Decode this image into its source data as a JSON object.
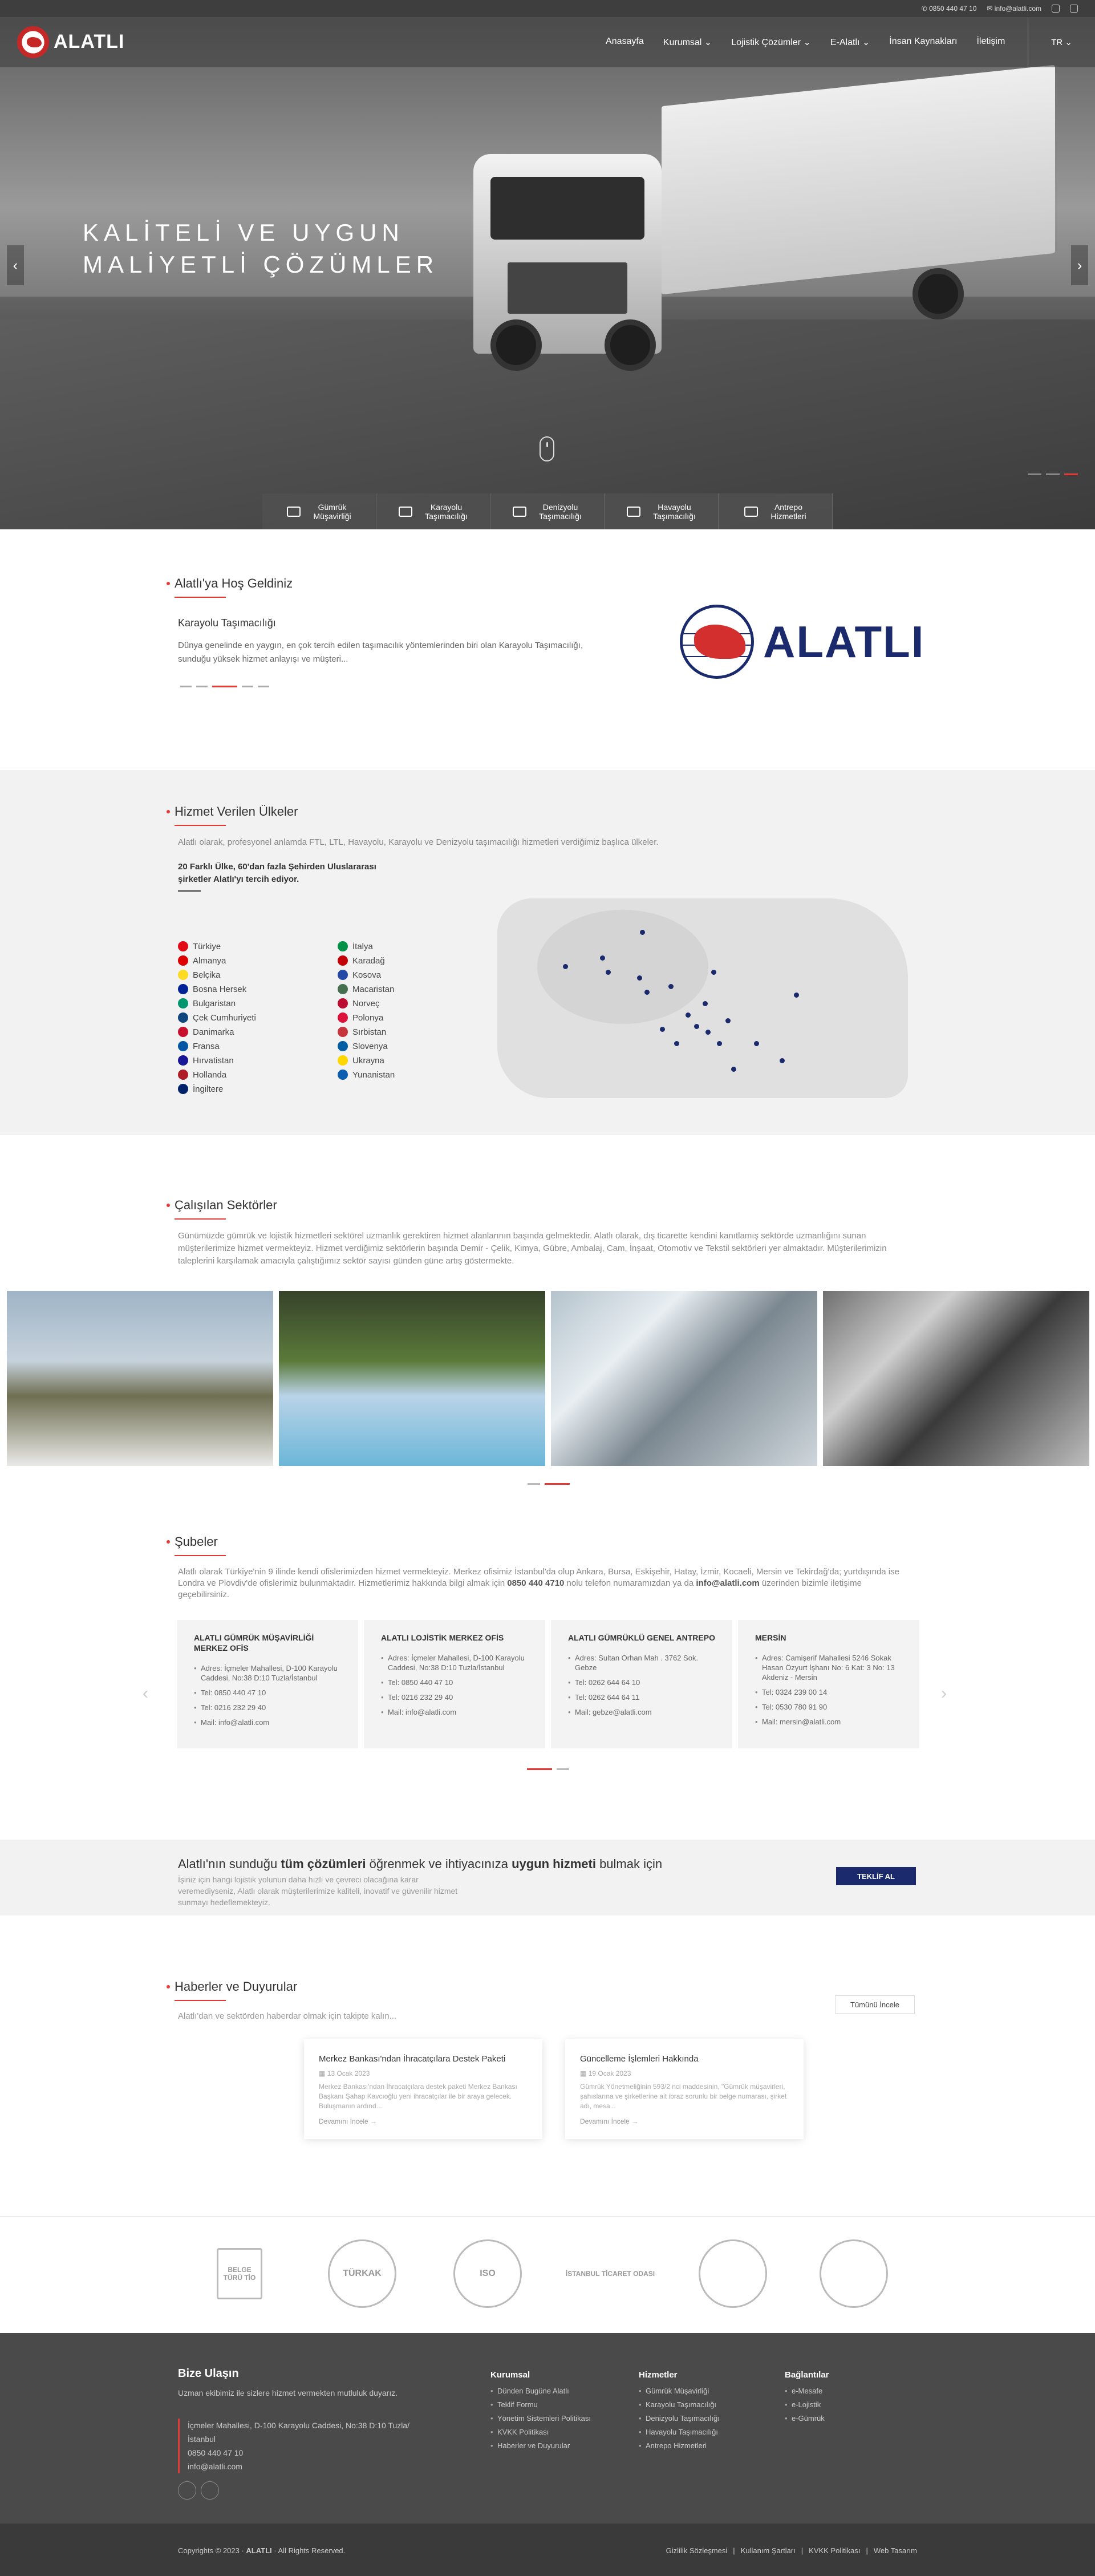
{
  "topbar": {
    "phone": "0850 440 47 10",
    "email": "info@alatli.com"
  },
  "brand": {
    "name": "ALATLI"
  },
  "nav": {
    "items": [
      "Anasayfa",
      "Kurumsal ⌄",
      "Lojistik Çözümler ⌄",
      "E-Alatlı ⌄",
      "İnsan Kaynakları",
      "İletişim"
    ],
    "lang": "TR ⌄"
  },
  "hero": {
    "title": "KALİTELİ VE UYGUN MALİYETLİ ÇÖZÜMLER",
    "prev": "‹",
    "next": "›",
    "services": [
      {
        "label": "Gümrük\nMüşavirliği"
      },
      {
        "label": "Karayolu\nTaşımacılığı"
      },
      {
        "label": "Denizyolu\nTaşımacılığı"
      },
      {
        "label": "Havayolu\nTaşımacılığı"
      },
      {
        "label": "Antrepo\nHizmetleri"
      }
    ]
  },
  "welcome": {
    "title": "Alatlı'ya Hoş Geldiniz",
    "subtitle": "Karayolu Taşımacılığı",
    "text": "Dünya genelinde en yaygın, en çok tercih edilen taşımacılık yöntemlerinden biri olan Karayolu Taşımacılığı, sunduğu yüksek hizmet anlayışı ve müşteri...",
    "logo_text": "ALATLI"
  },
  "countries": {
    "title": "Hizmet Verilen Ülkeler",
    "lead": "Alatlı olarak, profesyonel anlamda FTL, LTL, Havayolu, Karayolu ve Denizyolu taşımacılığı hizmetleri verdiğimiz başlıca ülkeler.",
    "count_text": "20 Farklı Ülke, 60'dan fazla Şehirden Uluslararası şirketler Alatlı'yı tercih ediyor.",
    "list": [
      {
        "name": "Türkiye",
        "color": "#e30a17"
      },
      {
        "name": "İtalya",
        "color": "#009246"
      },
      {
        "name": "Almanya",
        "color": "#dd0000"
      },
      {
        "name": "Karadağ",
        "color": "#c40308"
      },
      {
        "name": "Belçika",
        "color": "#fdda24"
      },
      {
        "name": "Kosova",
        "color": "#244aa5"
      },
      {
        "name": "Bosna Hersek",
        "color": "#002395"
      },
      {
        "name": "Macaristan",
        "color": "#477050"
      },
      {
        "name": "Bulgaristan",
        "color": "#00966e"
      },
      {
        "name": "Norveç",
        "color": "#ba0c2f"
      },
      {
        "name": "Çek Cumhuriyeti",
        "color": "#11457e"
      },
      {
        "name": "Polonya",
        "color": "#dc143c"
      },
      {
        "name": "Danimarka",
        "color": "#c8102e"
      },
      {
        "name": "Sırbistan",
        "color": "#c6363c"
      },
      {
        "name": "Fransa",
        "color": "#0055a4"
      },
      {
        "name": "Slovenya",
        "color": "#005da4"
      },
      {
        "name": "Hırvatistan",
        "color": "#171796"
      },
      {
        "name": "Ukrayna",
        "color": "#ffd700"
      },
      {
        "name": "Hollanda",
        "color": "#ae1c28"
      },
      {
        "name": "Yunanistan",
        "color": "#0d5eaf"
      },
      {
        "name": "İngiltere",
        "color": "#012169"
      }
    ]
  },
  "sectors": {
    "title": "Çalışılan Sektörler",
    "text": "Günümüzde gümrük ve lojistik hizmetleri sektörel uzmanlık gerektiren hizmet alanlarının başında gelmektedir. Alatlı olarak, dış ticarette kendini kanıtlamış sektörde uzmanlığını sunan müşterilerimize hizmet vermekteyiz. Hizmet verdiğimiz sektörlerin başında Demir - Çelik, Kimya, Gübre, Ambalaj, Cam, İnşaat, Otomotiv ve Tekstil sektörleri yer almaktadır. Müşterilerimizin taleplerini karşılamak amacıyla çalıştığımız sektör sayısı günden güne artış göstermekte."
  },
  "branches": {
    "title": "Şubeler",
    "text_a": "Alatlı olarak Türkiye'nin 9 ilinde kendi ofislerimizden hizmet vermekteyiz. Merkez ofisimiz İstanbul'da olup Ankara, Bursa, Eskişehir, Hatay, İzmir, Kocaeli, Mersin ve Tekirdağ'da; yurtdışında ise Londra ve Plovdiv'de ofislerimiz bulunmaktadır. Hizmetlerimiz hakkında bilgi almak için ",
    "phone_bold": "0850 440 4710",
    "text_b": " nolu telefon numaramızdan ya da ",
    "email_bold": "info@alatli.com",
    "text_c": " üzerinden bizimle iletişime geçebilirsiniz.",
    "cards": [
      {
        "title": "ALATLI GÜMRÜK MÜŞAVİRLİĞİ MERKEZ OFİS",
        "lines": [
          "Adres: İçmeler Mahallesi, D-100 Karayolu Caddesi, No:38 D:10 Tuzla/İstanbul",
          "Tel: 0850 440 47 10",
          "Tel: 0216 232 29 40",
          "Mail: info@alatli.com"
        ]
      },
      {
        "title": "ALATLI LOJİSTİK MERKEZ OFİS",
        "lines": [
          "Adres: İçmeler Mahallesi, D-100 Karayolu Caddesi, No:38 D:10 Tuzla/İstanbul",
          "Tel: 0850 440 47 10",
          "Tel: 0216 232 29 40",
          "Mail: info@alatli.com"
        ]
      },
      {
        "title": "ALATLI GÜMRÜKLÜ GENEL ANTREPO",
        "lines": [
          "Adres: Sultan Orhan Mah . 3762 Sok. Gebze",
          "Tel: 0262 644 64 10",
          "Tel: 0262 644 64 11",
          "Mail: gebze@alatli.com"
        ]
      },
      {
        "title": "MERSİN",
        "lines": [
          "Adres: Camişerif Mahallesi 5246 Sokak Hasan Özyurt İşhanı No: 6 Kat: 3 No: 13 Akdeniz - Mersin",
          "Tel: 0324 239 00 14",
          "Tel: 0530 780 91 90",
          "Mail: mersin@alatli.com"
        ]
      }
    ]
  },
  "cta": {
    "pre": "Alatlı'nın sunduğu ",
    "b1": "tüm çözümleri",
    "mid": " öğrenmek ve ihtiyacınıza ",
    "b2": "uygun hizmeti",
    "post": " bulmak için",
    "text": "İşiniz için hangi lojistik yolunun daha hızlı ve çevreci olacağına karar veremediyseniz, Alatlı olarak müşterilerimize kaliteli, inovatif ve güvenilir hizmet sunmayı hedeflemekteyiz.",
    "button": "TEKLİF AL"
  },
  "news": {
    "title": "Haberler ve Duyurular",
    "lead": "Alatlı'dan ve sektörden haberdar olmak için takipte kalın...",
    "all": "Tümünü İncele",
    "items": [
      {
        "title": "Merkez Bankası'ndan İhracatçılara Destek Paketi",
        "date": "13 Ocak 2023",
        "excerpt": "Merkez Bankası'ndan İhracatçılara destek paketi Merkez Bankası Başkanı Şahap Kavcıoğlu yeni ihracatçılar ile bir araya gelecek. Buluşmanın ardınd...",
        "more": "Devamını İncele →"
      },
      {
        "title": "Güncelleme İşlemleri Hakkında",
        "date": "19 Ocak 2023",
        "excerpt": "Gümrük Yönetmeliğinin 593/2 nci maddesinin, \"Gümrük müşavirleri, şahıslarına ve şirketlerine ait ibraz sorunlu bir belge numarası, şirket adı, mesa...",
        "more": "Devamını İncele →"
      }
    ]
  },
  "certs": [
    "BELGE TÜRÜ TİO",
    "TÜRKAK",
    "ISO",
    "İSTANBUL TİCARET ODASI",
    "",
    ""
  ],
  "footer": {
    "title": "Bize Ulaşın",
    "desc": "Uzman ekibimiz ile sizlere hizmet vermekten mutluluk duyarız.",
    "address": "İçmeler Mahallesi, D-100 Karayolu Caddesi, No:38 D:10 Tuzla/İstanbul",
    "phone": "0850 440 47 10",
    "email": "info@alatli.com",
    "cols": [
      {
        "title": "Kurumsal",
        "items": [
          "Dünden Bugüne Alatlı",
          "Teklif Formu",
          "Yönetim Sistemleri Politikası",
          "KVKK Politikası",
          "Haberler ve Duyurular"
        ]
      },
      {
        "title": "Hizmetler",
        "items": [
          "Gümrük Müşavirliği",
          "Karayolu Taşımacılığı",
          "Denizyolu Taşımacılığı",
          "Havayolu Taşımacılığı",
          "Antrepo Hizmetleri"
        ]
      },
      {
        "title": "Bağlantılar",
        "items": [
          "e-Mesafe",
          "e-Lojistik",
          "e-Gümrük"
        ]
      }
    ],
    "copyright_pre": "Copyrights © 2023 · ",
    "copyright_brand": "ALATLI",
    "copyright_post": " · All Rights Reserved.",
    "links": [
      "Gizlilik Sözleşmesi",
      "|",
      "Kullanım Şartları",
      "|",
      "KVKK Politikası",
      "|",
      "Web Tasarım"
    ]
  }
}
